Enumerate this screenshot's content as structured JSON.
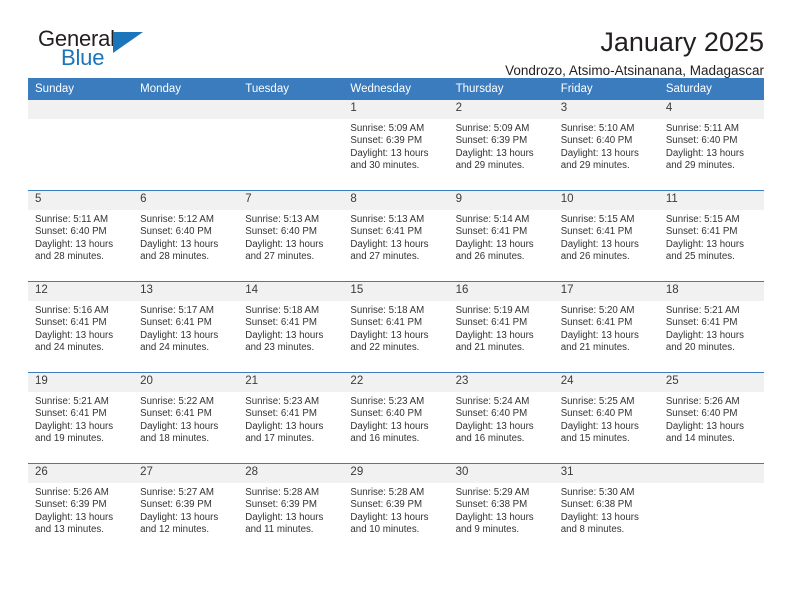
{
  "brand": {
    "line1": "General",
    "line2": "Blue",
    "mark_icon": "triangle-logo-icon",
    "accent_color": "#1b75bb"
  },
  "header": {
    "title": "January 2025",
    "subtitle": "Vondrozo, Atsimo-Atsinanana, Madagascar"
  },
  "theme": {
    "header_blue": "#3a7cbe",
    "day_band_gray": "#f1f1f1",
    "text": "#333333"
  },
  "weekday_headers": [
    "Sunday",
    "Monday",
    "Tuesday",
    "Wednesday",
    "Thursday",
    "Friday",
    "Saturday"
  ],
  "weeks": [
    [
      {
        "day": "",
        "sunrise": "",
        "sunset": "",
        "daylight1": "",
        "daylight2": ""
      },
      {
        "day": "",
        "sunrise": "",
        "sunset": "",
        "daylight1": "",
        "daylight2": ""
      },
      {
        "day": "",
        "sunrise": "",
        "sunset": "",
        "daylight1": "",
        "daylight2": ""
      },
      {
        "day": "1",
        "sunrise": "Sunrise: 5:09 AM",
        "sunset": "Sunset: 6:39 PM",
        "daylight1": "Daylight: 13 hours",
        "daylight2": "and 30 minutes."
      },
      {
        "day": "2",
        "sunrise": "Sunrise: 5:09 AM",
        "sunset": "Sunset: 6:39 PM",
        "daylight1": "Daylight: 13 hours",
        "daylight2": "and 29 minutes."
      },
      {
        "day": "3",
        "sunrise": "Sunrise: 5:10 AM",
        "sunset": "Sunset: 6:40 PM",
        "daylight1": "Daylight: 13 hours",
        "daylight2": "and 29 minutes."
      },
      {
        "day": "4",
        "sunrise": "Sunrise: 5:11 AM",
        "sunset": "Sunset: 6:40 PM",
        "daylight1": "Daylight: 13 hours",
        "daylight2": "and 29 minutes."
      }
    ],
    [
      {
        "day": "5",
        "sunrise": "Sunrise: 5:11 AM",
        "sunset": "Sunset: 6:40 PM",
        "daylight1": "Daylight: 13 hours",
        "daylight2": "and 28 minutes."
      },
      {
        "day": "6",
        "sunrise": "Sunrise: 5:12 AM",
        "sunset": "Sunset: 6:40 PM",
        "daylight1": "Daylight: 13 hours",
        "daylight2": "and 28 minutes."
      },
      {
        "day": "7",
        "sunrise": "Sunrise: 5:13 AM",
        "sunset": "Sunset: 6:40 PM",
        "daylight1": "Daylight: 13 hours",
        "daylight2": "and 27 minutes."
      },
      {
        "day": "8",
        "sunrise": "Sunrise: 5:13 AM",
        "sunset": "Sunset: 6:41 PM",
        "daylight1": "Daylight: 13 hours",
        "daylight2": "and 27 minutes."
      },
      {
        "day": "9",
        "sunrise": "Sunrise: 5:14 AM",
        "sunset": "Sunset: 6:41 PM",
        "daylight1": "Daylight: 13 hours",
        "daylight2": "and 26 minutes."
      },
      {
        "day": "10",
        "sunrise": "Sunrise: 5:15 AM",
        "sunset": "Sunset: 6:41 PM",
        "daylight1": "Daylight: 13 hours",
        "daylight2": "and 26 minutes."
      },
      {
        "day": "11",
        "sunrise": "Sunrise: 5:15 AM",
        "sunset": "Sunset: 6:41 PM",
        "daylight1": "Daylight: 13 hours",
        "daylight2": "and 25 minutes."
      }
    ],
    [
      {
        "day": "12",
        "sunrise": "Sunrise: 5:16 AM",
        "sunset": "Sunset: 6:41 PM",
        "daylight1": "Daylight: 13 hours",
        "daylight2": "and 24 minutes."
      },
      {
        "day": "13",
        "sunrise": "Sunrise: 5:17 AM",
        "sunset": "Sunset: 6:41 PM",
        "daylight1": "Daylight: 13 hours",
        "daylight2": "and 24 minutes."
      },
      {
        "day": "14",
        "sunrise": "Sunrise: 5:18 AM",
        "sunset": "Sunset: 6:41 PM",
        "daylight1": "Daylight: 13 hours",
        "daylight2": "and 23 minutes."
      },
      {
        "day": "15",
        "sunrise": "Sunrise: 5:18 AM",
        "sunset": "Sunset: 6:41 PM",
        "daylight1": "Daylight: 13 hours",
        "daylight2": "and 22 minutes."
      },
      {
        "day": "16",
        "sunrise": "Sunrise: 5:19 AM",
        "sunset": "Sunset: 6:41 PM",
        "daylight1": "Daylight: 13 hours",
        "daylight2": "and 21 minutes."
      },
      {
        "day": "17",
        "sunrise": "Sunrise: 5:20 AM",
        "sunset": "Sunset: 6:41 PM",
        "daylight1": "Daylight: 13 hours",
        "daylight2": "and 21 minutes."
      },
      {
        "day": "18",
        "sunrise": "Sunrise: 5:21 AM",
        "sunset": "Sunset: 6:41 PM",
        "daylight1": "Daylight: 13 hours",
        "daylight2": "and 20 minutes."
      }
    ],
    [
      {
        "day": "19",
        "sunrise": "Sunrise: 5:21 AM",
        "sunset": "Sunset: 6:41 PM",
        "daylight1": "Daylight: 13 hours",
        "daylight2": "and 19 minutes."
      },
      {
        "day": "20",
        "sunrise": "Sunrise: 5:22 AM",
        "sunset": "Sunset: 6:41 PM",
        "daylight1": "Daylight: 13 hours",
        "daylight2": "and 18 minutes."
      },
      {
        "day": "21",
        "sunrise": "Sunrise: 5:23 AM",
        "sunset": "Sunset: 6:41 PM",
        "daylight1": "Daylight: 13 hours",
        "daylight2": "and 17 minutes."
      },
      {
        "day": "22",
        "sunrise": "Sunrise: 5:23 AM",
        "sunset": "Sunset: 6:40 PM",
        "daylight1": "Daylight: 13 hours",
        "daylight2": "and 16 minutes."
      },
      {
        "day": "23",
        "sunrise": "Sunrise: 5:24 AM",
        "sunset": "Sunset: 6:40 PM",
        "daylight1": "Daylight: 13 hours",
        "daylight2": "and 16 minutes."
      },
      {
        "day": "24",
        "sunrise": "Sunrise: 5:25 AM",
        "sunset": "Sunset: 6:40 PM",
        "daylight1": "Daylight: 13 hours",
        "daylight2": "and 15 minutes."
      },
      {
        "day": "25",
        "sunrise": "Sunrise: 5:26 AM",
        "sunset": "Sunset: 6:40 PM",
        "daylight1": "Daylight: 13 hours",
        "daylight2": "and 14 minutes."
      }
    ],
    [
      {
        "day": "26",
        "sunrise": "Sunrise: 5:26 AM",
        "sunset": "Sunset: 6:39 PM",
        "daylight1": "Daylight: 13 hours",
        "daylight2": "and 13 minutes."
      },
      {
        "day": "27",
        "sunrise": "Sunrise: 5:27 AM",
        "sunset": "Sunset: 6:39 PM",
        "daylight1": "Daylight: 13 hours",
        "daylight2": "and 12 minutes."
      },
      {
        "day": "28",
        "sunrise": "Sunrise: 5:28 AM",
        "sunset": "Sunset: 6:39 PM",
        "daylight1": "Daylight: 13 hours",
        "daylight2": "and 11 minutes."
      },
      {
        "day": "29",
        "sunrise": "Sunrise: 5:28 AM",
        "sunset": "Sunset: 6:39 PM",
        "daylight1": "Daylight: 13 hours",
        "daylight2": "and 10 minutes."
      },
      {
        "day": "30",
        "sunrise": "Sunrise: 5:29 AM",
        "sunset": "Sunset: 6:38 PM",
        "daylight1": "Daylight: 13 hours",
        "daylight2": "and 9 minutes."
      },
      {
        "day": "31",
        "sunrise": "Sunrise: 5:30 AM",
        "sunset": "Sunset: 6:38 PM",
        "daylight1": "Daylight: 13 hours",
        "daylight2": "and 8 minutes."
      },
      {
        "day": "",
        "sunrise": "",
        "sunset": "",
        "daylight1": "",
        "daylight2": ""
      }
    ]
  ]
}
